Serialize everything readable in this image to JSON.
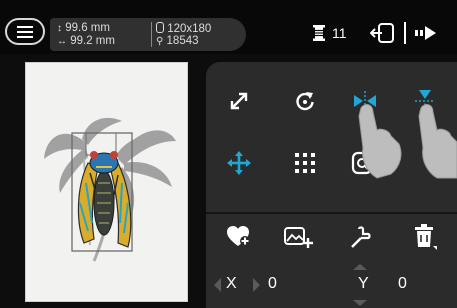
{
  "status": {
    "size_v": "99.6 mm",
    "size_h": "99.2 mm",
    "hoop": "120x180",
    "stitch_count": "18543",
    "needle_number": "11"
  },
  "coords": {
    "x_label": "X",
    "x_value": "0",
    "y_label": "Y",
    "y_value": "0"
  },
  "colors": {
    "accent": "#1fa8d6",
    "panel": "#2b2b2b",
    "background": "#0d0d0d",
    "canvas": "#f2f2f0"
  },
  "icons": {
    "top": [
      "menu-icon",
      "vertical-arrows-icon",
      "horizontal-arrows-icon",
      "hoop-icon",
      "stitch-icon",
      "spool-icon",
      "frame-return-icon",
      "next-icon"
    ],
    "tools": [
      "resize-icon",
      "rotate-icon",
      "mirror-horizontal-icon",
      "mirror-vertical-icon",
      "move-icon",
      "grid-dots-icon",
      "zoom-icon",
      "add-favorite-icon",
      "add-image-icon",
      "pick-icon",
      "delete-icon"
    ]
  }
}
